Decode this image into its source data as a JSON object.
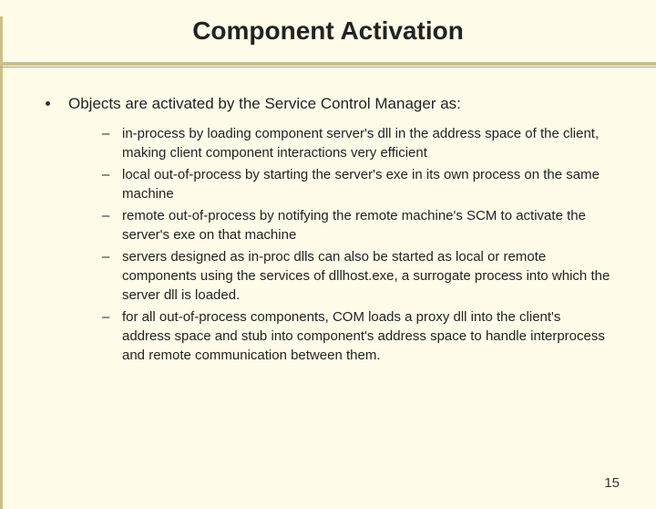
{
  "title": "Component Activation",
  "main_bullet": "Objects are activated by the Service Control Manager as:",
  "sub_items": [
    "in-process by loading component server's dll in the address space of the client, making client component interactions very efficient",
    "local out-of-process by starting the server's exe in its own process on the same machine",
    "remote out-of-process by notifying the remote machine's SCM to activate the server's exe on that machine",
    "servers designed as in-proc dlls can also be started as local or remote components using the services of dllhost.exe, a surrogate process into which the server dll is loaded.",
    "for all out-of-process components, COM loads a proxy dll into the client's address space and stub into component's address space to handle interprocess and remote communication between them."
  ],
  "page_number": "15"
}
